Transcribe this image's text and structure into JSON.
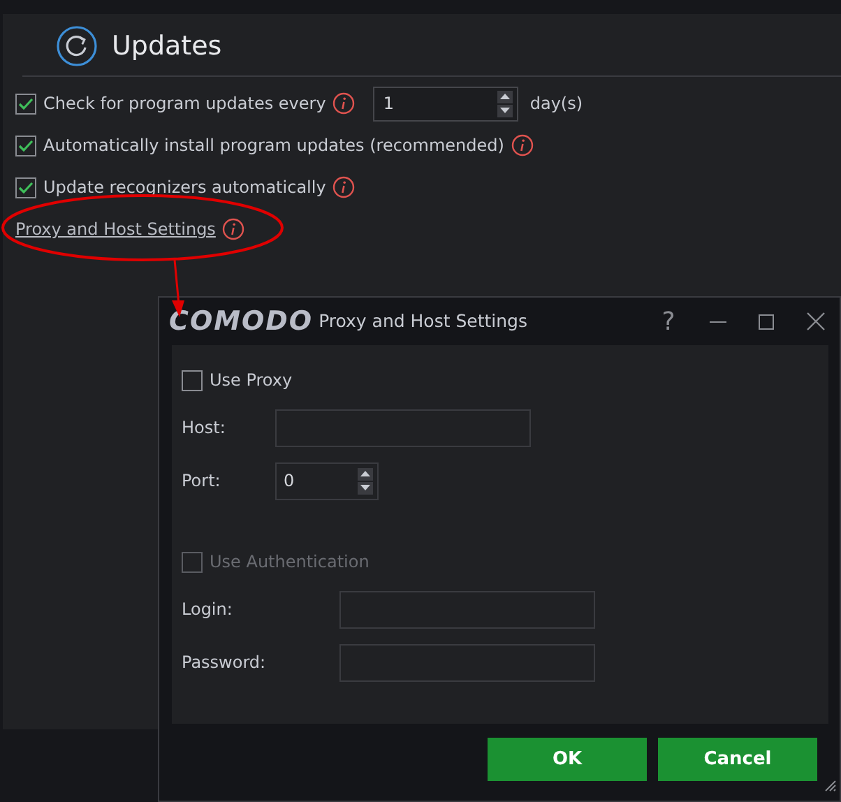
{
  "section": {
    "title": "Updates",
    "options": [
      {
        "kind": "checkbox",
        "label": "Check for program updates every",
        "checked": true,
        "spinner": {
          "value": "1",
          "unit": "day(s)"
        }
      },
      {
        "kind": "checkbox",
        "label": "Automatically install program updates (recommended)",
        "checked": true
      },
      {
        "kind": "checkbox",
        "label": "Update recognizers automatically",
        "checked": true
      },
      {
        "kind": "link",
        "label": "Proxy and Host Settings"
      }
    ]
  },
  "dialog": {
    "logo": "COMODO",
    "title": "Proxy and Host Settings",
    "help": "?",
    "groups": [
      {
        "toggle": {
          "label": "Use Proxy",
          "checked": false,
          "disabled": false
        },
        "fields": [
          {
            "kind": "text",
            "label": "Host:"
          },
          {
            "kind": "spin",
            "label": "Port:",
            "value": "0"
          }
        ]
      },
      {
        "toggle": {
          "label": "Use Authentication",
          "checked": false,
          "disabled": true
        },
        "fields": [
          {
            "kind": "text",
            "label": "Login:"
          },
          {
            "kind": "text",
            "label": "Password:"
          }
        ]
      }
    ],
    "buttons": [
      "OK",
      "Cancel"
    ]
  }
}
